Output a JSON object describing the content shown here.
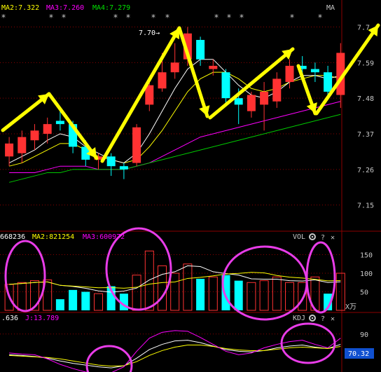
{
  "price_header": {
    "ma2_label": "MA2:7.322",
    "ma3_label": "MA3:7.260",
    "ma4_label": "MA4:7.279",
    "indicator_tag": "MA"
  },
  "price_annotation": "7.70→",
  "vol_header": {
    "ma1_label": "668236",
    "ma2_label": "MA2:821254",
    "ma3_label": "MA3:600972",
    "panel_tag": "VOL",
    "unit_label": "X万"
  },
  "kdj_header": {
    "d_label": ".636",
    "j_label": "J:13.789",
    "panel_tag": "KDJ"
  },
  "kdj_readout": "70.32",
  "icons": [
    "gear-icon",
    "question-icon",
    "close-icon"
  ],
  "colors": {
    "up": "#ff3232",
    "down": "#00ffff",
    "ma_white": "#ffffff",
    "ma_yellow": "#ffff00",
    "ma_magenta": "#ff00ff",
    "ma_green": "#00c800",
    "arrow": "#ffff00",
    "circle": "#e83ce8",
    "grid": "#8b0000",
    "axis_text": "#c8c8c8",
    "readout_bg": "#1050d0"
  },
  "chart_data": [
    {
      "type": "candlestick",
      "panel": "price",
      "y_ticks": [
        "7.7",
        "7.59",
        "7.48",
        "7.37",
        "7.26",
        "7.15"
      ],
      "ylim": [
        7.08,
        7.74
      ],
      "candles": [
        {
          "o": 7.3,
          "h": 7.36,
          "l": 7.27,
          "c": 7.34
        },
        {
          "o": 7.31,
          "h": 7.38,
          "l": 7.28,
          "c": 7.36
        },
        {
          "o": 7.35,
          "h": 7.4,
          "l": 7.32,
          "c": 7.38
        },
        {
          "o": 7.37,
          "h": 7.42,
          "l": 7.34,
          "c": 7.4
        },
        {
          "o": 7.41,
          "h": 7.44,
          "l": 7.38,
          "c": 7.4
        },
        {
          "o": 7.4,
          "h": 7.41,
          "l": 7.31,
          "c": 7.33
        },
        {
          "o": 7.33,
          "h": 7.35,
          "l": 7.27,
          "c": 7.29
        },
        {
          "o": 7.29,
          "h": 7.31,
          "l": 7.26,
          "c": 7.3
        },
        {
          "o": 7.3,
          "h": 7.31,
          "l": 7.24,
          "c": 7.27
        },
        {
          "o": 7.27,
          "h": 7.28,
          "l": 7.23,
          "c": 7.26
        },
        {
          "o": 7.28,
          "h": 7.4,
          "l": 7.27,
          "c": 7.39
        },
        {
          "o": 7.46,
          "h": 7.54,
          "l": 7.44,
          "c": 7.52
        },
        {
          "o": 7.51,
          "h": 7.62,
          "l": 7.5,
          "c": 7.56
        },
        {
          "o": 7.56,
          "h": 7.65,
          "l": 7.54,
          "c": 7.59
        },
        {
          "o": 7.6,
          "h": 7.7,
          "l": 7.58,
          "c": 7.68
        },
        {
          "o": 7.66,
          "h": 7.67,
          "l": 7.58,
          "c": 7.6
        },
        {
          "o": 7.57,
          "h": 7.6,
          "l": 7.55,
          "c": 7.58
        },
        {
          "o": 7.56,
          "h": 7.57,
          "l": 7.46,
          "c": 7.48
        },
        {
          "o": 7.48,
          "h": 7.51,
          "l": 7.4,
          "c": 7.46
        },
        {
          "o": 7.44,
          "h": 7.5,
          "l": 7.42,
          "c": 7.49
        },
        {
          "o": 7.46,
          "h": 7.53,
          "l": 7.38,
          "c": 7.5
        },
        {
          "o": 7.47,
          "h": 7.56,
          "l": 7.45,
          "c": 7.54
        },
        {
          "o": 7.53,
          "h": 7.6,
          "l": 7.51,
          "c": 7.58
        },
        {
          "o": 7.58,
          "h": 7.61,
          "l": 7.54,
          "c": 7.57
        },
        {
          "o": 7.57,
          "h": 7.59,
          "l": 7.53,
          "c": 7.56
        },
        {
          "o": 7.56,
          "h": 7.58,
          "l": 7.48,
          "c": 7.5
        },
        {
          "o": 7.49,
          "h": 7.65,
          "l": 7.45,
          "c": 7.62
        }
      ],
      "ma_series": [
        {
          "name": "MA2",
          "color": "#ffff00",
          "values": [
            7.27,
            7.28,
            7.3,
            7.32,
            7.34,
            7.34,
            7.32,
            7.3,
            7.29,
            7.28,
            7.29,
            7.33,
            7.38,
            7.44,
            7.5,
            7.54,
            7.56,
            7.56,
            7.54,
            7.51,
            7.5,
            7.51,
            7.53,
            7.54,
            7.55,
            7.55,
            7.54
          ]
        },
        {
          "name": "MA3",
          "color": "#ff00ff",
          "values": [
            7.25,
            7.25,
            7.25,
            7.26,
            7.27,
            7.27,
            7.27,
            7.26,
            7.26,
            7.26,
            7.27,
            7.28,
            7.3,
            7.32,
            7.34,
            7.36,
            7.37,
            7.38,
            7.39,
            7.4,
            7.41,
            7.42,
            7.43,
            7.44,
            7.45,
            7.46,
            7.47
          ]
        },
        {
          "name": "MA4",
          "color": "#00c800",
          "values": [
            7.22,
            7.23,
            7.24,
            7.25,
            7.25,
            7.26,
            7.26,
            7.26,
            7.26,
            7.26,
            7.27,
            7.28,
            7.29,
            7.3,
            7.31,
            7.32,
            7.33,
            7.34,
            7.35,
            7.36,
            7.37,
            7.38,
            7.39,
            7.4,
            7.41,
            7.42,
            7.43
          ]
        },
        {
          "name": "",
          "color": "#ffffff",
          "values": [
            7.28,
            7.3,
            7.32,
            7.35,
            7.37,
            7.36,
            7.33,
            7.31,
            7.29,
            7.28,
            7.31,
            7.37,
            7.44,
            7.51,
            7.57,
            7.6,
            7.6,
            7.56,
            7.52,
            7.49,
            7.48,
            7.5,
            7.53,
            7.55,
            7.55,
            7.54,
            7.55
          ]
        }
      ]
    },
    {
      "type": "bar",
      "panel": "volume",
      "y_ticks": [
        "150",
        "100",
        "50"
      ],
      "ylim": [
        0,
        185
      ],
      "values": [
        70,
        75,
        80,
        82,
        30,
        55,
        50,
        45,
        65,
        45,
        95,
        160,
        120,
        100,
        125,
        85,
        90,
        95,
        80,
        75,
        80,
        90,
        75,
        75,
        90,
        45,
        100
      ],
      "up": [
        true,
        true,
        true,
        true,
        false,
        false,
        false,
        true,
        false,
        false,
        true,
        true,
        true,
        true,
        true,
        false,
        true,
        false,
        false,
        true,
        true,
        true,
        true,
        true,
        true,
        false,
        true
      ]
    },
    {
      "type": "line",
      "panel": "kdj",
      "y_ticks": [
        "90"
      ],
      "ylim": [
        -20,
        120
      ],
      "series": [
        {
          "name": "",
          "color": "#ffffff",
          "values": [
            30,
            28,
            25,
            20,
            12,
            5,
            0,
            -5,
            -8,
            -2,
            20,
            45,
            60,
            70,
            72,
            65,
            55,
            45,
            40,
            38,
            42,
            50,
            55,
            58,
            52,
            48,
            60
          ]
        },
        {
          "name": "",
          "color": "#ffff00",
          "values": [
            28,
            26,
            24,
            22,
            18,
            12,
            6,
            0,
            -3,
            -2,
            10,
            28,
            42,
            52,
            58,
            58,
            54,
            48,
            44,
            42,
            42,
            46,
            50,
            52,
            50,
            48,
            54
          ]
        },
        {
          "name": "J",
          "color": "#ff00ff",
          "values": [
            35,
            32,
            30,
            18,
            2,
            -10,
            -20,
            -25,
            -22,
            -5,
            40,
            78,
            95,
            100,
            98,
            80,
            60,
            40,
            30,
            35,
            50,
            60,
            68,
            72,
            60,
            50,
            78
          ]
        }
      ]
    }
  ]
}
